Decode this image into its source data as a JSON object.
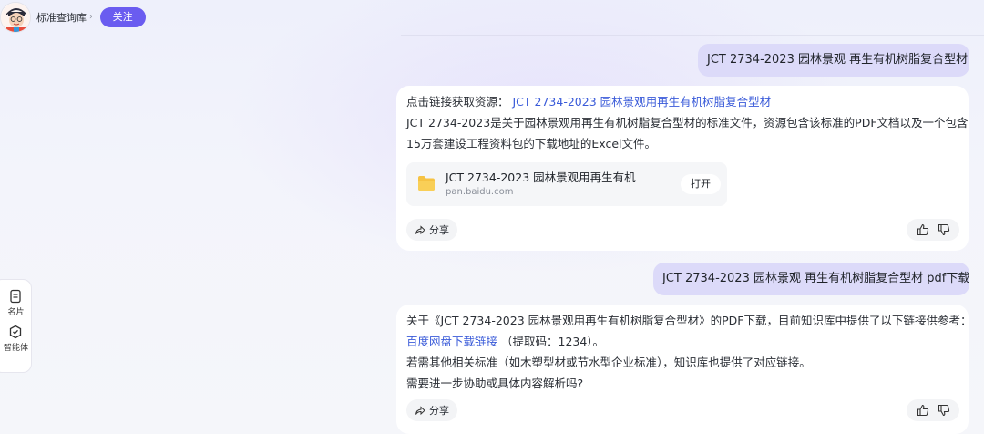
{
  "header": {
    "bot_name": "标准查询库",
    "follow_label": "关注"
  },
  "sidebar": {
    "items": [
      {
        "label": "名片",
        "icon": "card-icon"
      },
      {
        "label": "智能体",
        "icon": "agent-icon"
      }
    ]
  },
  "messages": {
    "user_1": "JCT 2734-2023 园林景观 再生有机树脂复合型材",
    "bot_1": {
      "prefix": "点击链接获取资源：",
      "link": "JCT 2734-2023 园林景观用再生有机树脂复合型材",
      "line_1": "JCT 2734-2023是关于园林景观用再生有机树脂复合型材的标准文件，资源包含该标准的PDF文档以及一个包含",
      "line_2": "15万套建设工程资料包的下载地址的Excel文件。",
      "file": {
        "title": "JCT 2734-2023 园林景观用再生有机",
        "domain": "pan.baidu.com",
        "open_label": "打开",
        "icon": "folder-icon"
      },
      "share_label": "分享"
    },
    "user_2": "JCT 2734-2023 园林景观 再生有机树脂复合型材 pdf下载",
    "bot_2": {
      "line_1": "关于《JCT 2734-2023 园林景观用再生有机树脂复合型材》的PDF下载，目前知识库中提供了以下链接供参考：",
      "link": "百度网盘下载链接",
      "code": "（提取码：1234）。",
      "line_3": "若需其他相关标准（如木塑型材或节水型企业标准），知识库也提供了对应链接。",
      "line_4": "需要进一步协助或具体内容解析吗?",
      "share_label": "分享"
    }
  },
  "colors": {
    "accent": "#6a5cf0",
    "user_bubble": "#dcdaf9",
    "link": "#3a5bd9",
    "folder": "#f6c343"
  }
}
